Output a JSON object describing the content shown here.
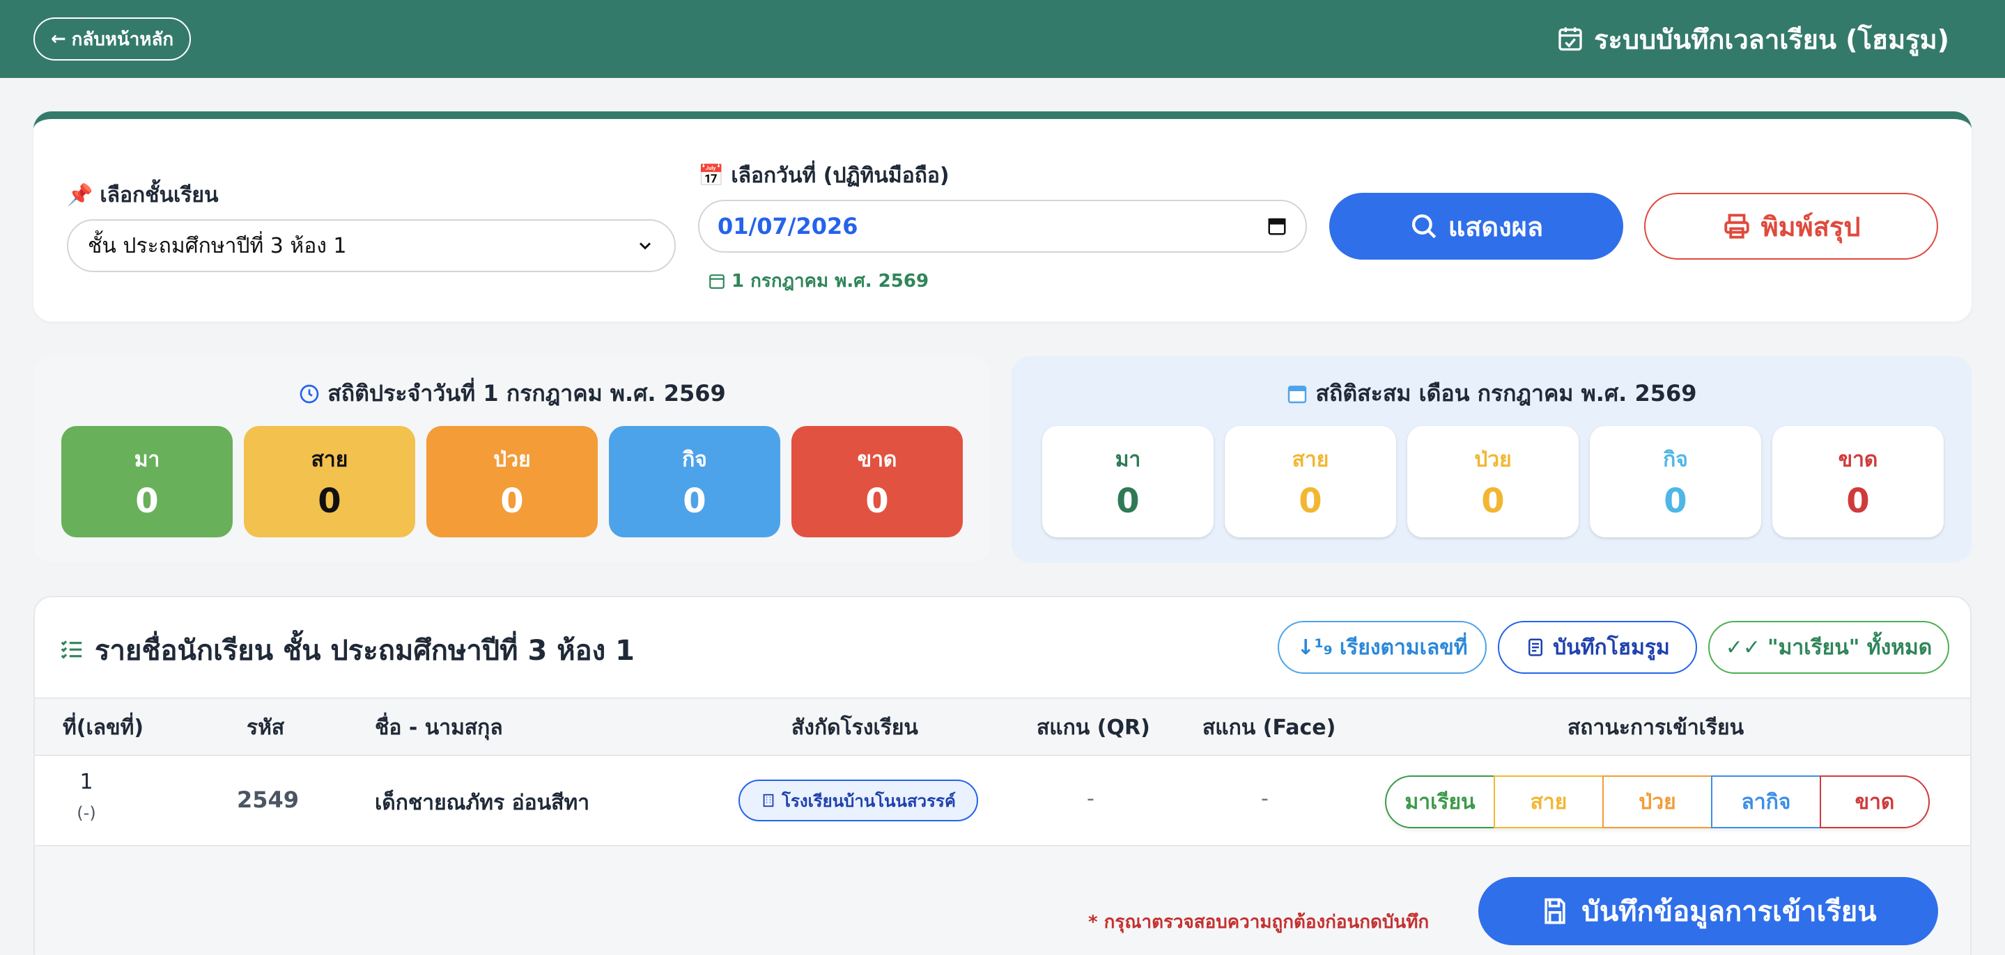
{
  "header": {
    "back_label": "กลับหน้าหลัก",
    "title": "ระบบบันทึกเวลาเรียน (โฮมรูม)",
    "bg_color": "#347a6a"
  },
  "filters": {
    "class_label": "เลือกชั้นเรียน",
    "class_value": "ชั้น ประถมศึกษาปีที่ 3 ห้อง 1",
    "date_label": "เลือกวันที่ (ปฏิทินมือถือ)",
    "date_value": "01/07/2026",
    "thai_date": "1 กรกฎาคม พ.ศ. 2569",
    "show_label": "แสดงผล",
    "print_label": "พิมพ์สรุป"
  },
  "daily_stats": {
    "title": "สถิติประจำวันที่ 1 กรกฎาคม พ.ศ. 2569",
    "items": [
      {
        "label": "มา",
        "value": "0",
        "color": "#68b05a"
      },
      {
        "label": "สาย",
        "value": "0",
        "color": "#f2c14e"
      },
      {
        "label": "ป่วย",
        "value": "0",
        "color": "#f39c38"
      },
      {
        "label": "กิจ",
        "value": "0",
        "color": "#4da3ea"
      },
      {
        "label": "ขาด",
        "value": "0",
        "color": "#e25240"
      }
    ]
  },
  "monthly_stats": {
    "title": "สถิติสะสม เดือน กรกฎาคม พ.ศ. 2569",
    "items": [
      {
        "label": "มา",
        "value": "0",
        "color": "#2f7a55"
      },
      {
        "label": "สาย",
        "value": "0",
        "color": "#f2b632"
      },
      {
        "label": "ป่วย",
        "value": "0",
        "color": "#f2b632"
      },
      {
        "label": "กิจ",
        "value": "0",
        "color": "#4fb6e6"
      },
      {
        "label": "ขาด",
        "value": "0",
        "color": "#d03a3a"
      }
    ]
  },
  "student_list": {
    "title": "รายชื่อนักเรียน ชั้น ประถมศึกษาปีที่ 3 ห้อง 1",
    "sort_label": "เรียงตามเลขที่",
    "save_homeroom_label": "บันทึกโฮมรูม",
    "all_present_label": "\"มาเรียน\" ทั้งหมด",
    "columns": [
      "ที่(เลขที่)",
      "รหัส",
      "ชื่อ - นามสกุล",
      "สังกัดโรงเรียน",
      "สแกน (QR)",
      "สแกน (Face)",
      "สถานะการเข้าเรียน"
    ],
    "rows": [
      {
        "no": "1",
        "no_sub": "(-)",
        "code": "2549",
        "name": "เด็กชายณภัทร อ่อนสีทา",
        "school": "โรงเรียนบ้านโนนสวรรค์",
        "qr": "-",
        "face": "-",
        "status_options": [
          {
            "label": "มาเรียน",
            "color": "#3a9a4a"
          },
          {
            "label": "สาย",
            "color": "#f2b632"
          },
          {
            "label": "ป่วย",
            "color": "#f39c38"
          },
          {
            "label": "ลากิจ",
            "color": "#3b8ee8"
          },
          {
            "label": "ขาด",
            "color": "#d03a3a"
          }
        ]
      }
    ]
  },
  "footer": {
    "warning": "* กรุณาตรวจสอบความถูกต้องก่อนกดบันทึก",
    "save_label": "บันทึกข้อมูลการเข้าเรียน"
  }
}
